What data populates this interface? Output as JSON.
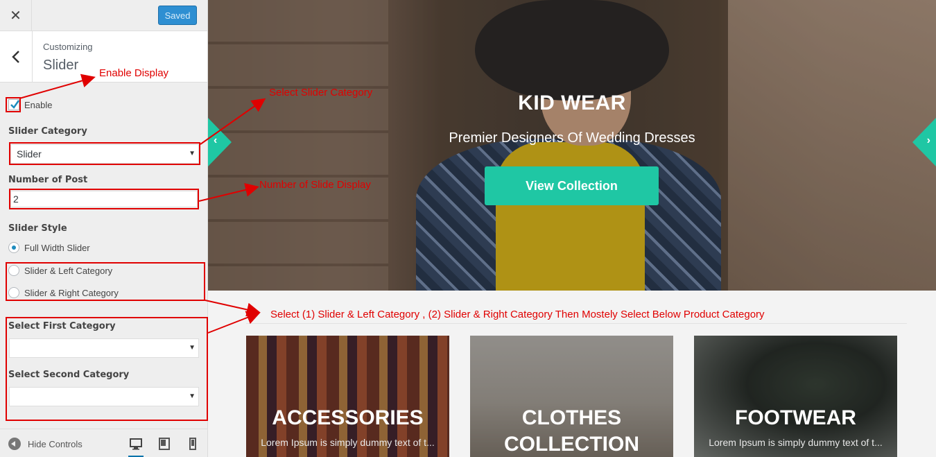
{
  "topbar": {
    "close_glyph": "✕",
    "saved_label": "Saved"
  },
  "section": {
    "breadcrumb": "Customizing",
    "title": "Slider"
  },
  "controls": {
    "enable_label": "Enable",
    "enable_checked": true,
    "slider_category_label": "Slider Category",
    "slider_category_value": "Slider",
    "number_of_post_label": "Number of Post",
    "number_of_post_value": "2",
    "slider_style_label": "Slider Style",
    "slider_style_options": [
      "Full Width Slider",
      "Slider & Left Category",
      "Slider & Right Category"
    ],
    "slider_style_selected": "Full Width Slider",
    "first_category_label": "Select First Category",
    "first_category_value": "",
    "second_category_label": "Select Second Category",
    "second_category_value": ""
  },
  "footer": {
    "hide_controls_label": "Hide Controls",
    "devices": [
      "desktop-icon",
      "tablet-icon",
      "mobile-icon"
    ],
    "active_device": "desktop"
  },
  "hero": {
    "title": "KID WEAR",
    "subtitle": "Premier Designers Of Wedding Dresses",
    "button_label": "View Collection",
    "prev_glyph": "‹",
    "next_glyph": "›",
    "accent_color": "#1fc7a4"
  },
  "cards": [
    {
      "title": "ACCESSORIES",
      "text": "Lorem Ipsum is simply dummy text of t..."
    },
    {
      "title": "CLOTHES COLLECTION",
      "text": ""
    },
    {
      "title": "FOOTWEAR",
      "text": "Lorem Ipsum is simply dummy text of t..."
    }
  ],
  "annotations": {
    "enable_display": "Enable Display",
    "select_slider_category": "Select Slider Category",
    "number_of_slide": "Number of Slide Display",
    "select_style_note": "Select  (1) Slider & Left Category , (2) Slider & Right Category Then Mostely Select Below Product Category",
    "color": "#e00000"
  }
}
